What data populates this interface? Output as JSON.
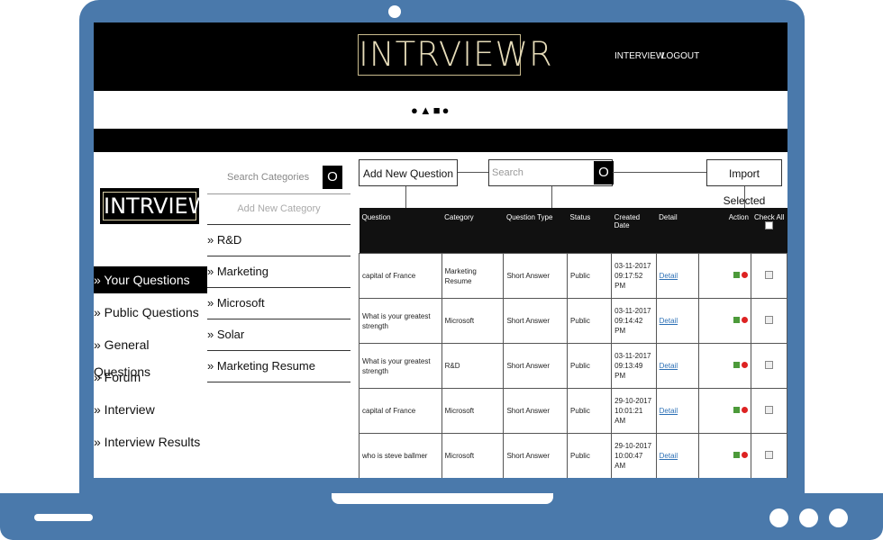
{
  "header": {
    "logo": "INTRVIEWR",
    "nav": [
      "INTERVIEW",
      "LOGOUT"
    ],
    "shapes": "●▲■●"
  },
  "sidebar": {
    "logo": "INTRVIEWR",
    "items": [
      {
        "label": "» Your Questions",
        "active": true
      },
      {
        "label": "» Public Questions"
      },
      {
        "label": "» General Questions"
      },
      {
        "label": "» Forum"
      },
      {
        "label": "» Interview"
      },
      {
        "label": "» Interview Results"
      }
    ]
  },
  "categories": {
    "search_placeholder": "Search Categories",
    "search_btn": "O",
    "add_label": "Add New Category",
    "items": [
      "» R&D",
      "» Marketing",
      "» Microsoft",
      "» Solar",
      "» Marketing Resume"
    ]
  },
  "main": {
    "add_btn": "Add New Question",
    "search_placeholder": "Search",
    "search_btn": "O",
    "import_btn": "Import Selected",
    "columns": [
      "Question",
      "Category",
      "Question Type",
      "Status",
      "Created Date",
      "Detail",
      "Action",
      "Check All"
    ],
    "rows": [
      {
        "question": "capital of France",
        "category": "Marketing Resume",
        "type": "Short Answer",
        "status": "Public",
        "created": "03-11-2017 09:17:52 PM",
        "detail": "Detail"
      },
      {
        "question": "What is your greatest strength",
        "category": "Microsoft",
        "type": "Short Answer",
        "status": "Public",
        "created": "03-11-2017 09:14:42 PM",
        "detail": "Detail"
      },
      {
        "question": "What is your greatest strength",
        "category": "R&D",
        "type": "Short Answer",
        "status": "Public",
        "created": "03-11-2017 09:13:49 PM",
        "detail": "Detail"
      },
      {
        "question": "capital of France",
        "category": "Microsoft",
        "type": "Short Answer",
        "status": "Public",
        "created": "29-10-2017 10:01:21 AM",
        "detail": "Detail"
      },
      {
        "question": "who is steve ballmer",
        "category": "Microsoft",
        "type": "Short Answer",
        "status": "Public",
        "created": "29-10-2017 10:00:47 AM",
        "detail": "Detail"
      }
    ]
  },
  "colors": {
    "frame": "#4a79ab",
    "dark": "#000000",
    "link": "#2b6fb5"
  }
}
